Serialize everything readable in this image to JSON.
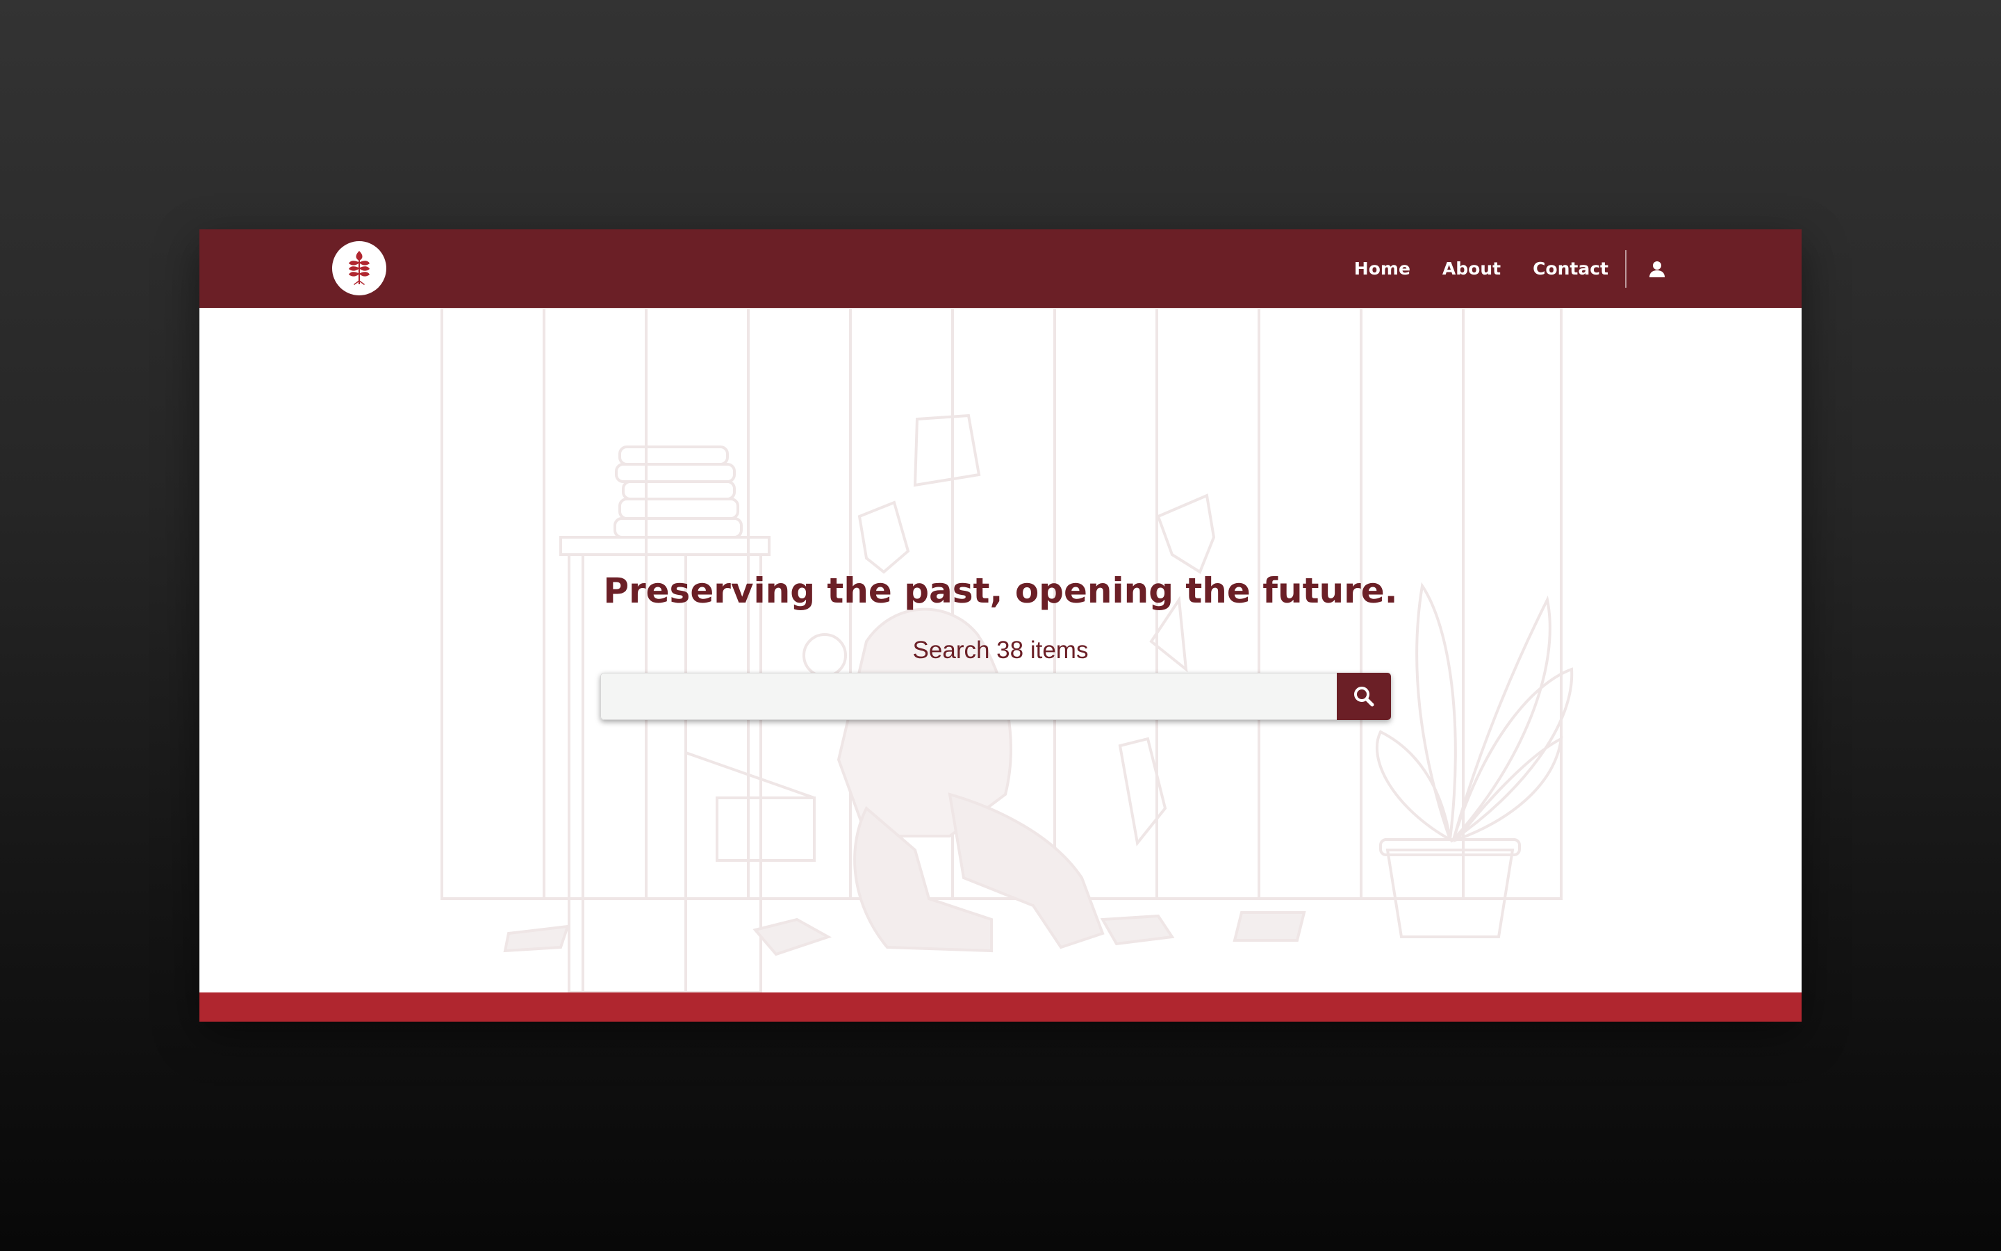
{
  "colors": {
    "brand_dark": "#6b1f26",
    "brand_red": "#b0262f",
    "illustration_line": "#efe8e8",
    "input_bg": "#f4f5f4"
  },
  "header": {
    "logo_icon": "wheat-leaf-icon",
    "nav": [
      {
        "label": "Home"
      },
      {
        "label": "About"
      },
      {
        "label": "Contact"
      }
    ],
    "user_icon": "user-icon"
  },
  "hero": {
    "title": "Preserving the past, opening the future.",
    "subtitle": "Search 38 items",
    "search": {
      "value": "",
      "placeholder": "",
      "button_icon": "search-icon"
    }
  }
}
